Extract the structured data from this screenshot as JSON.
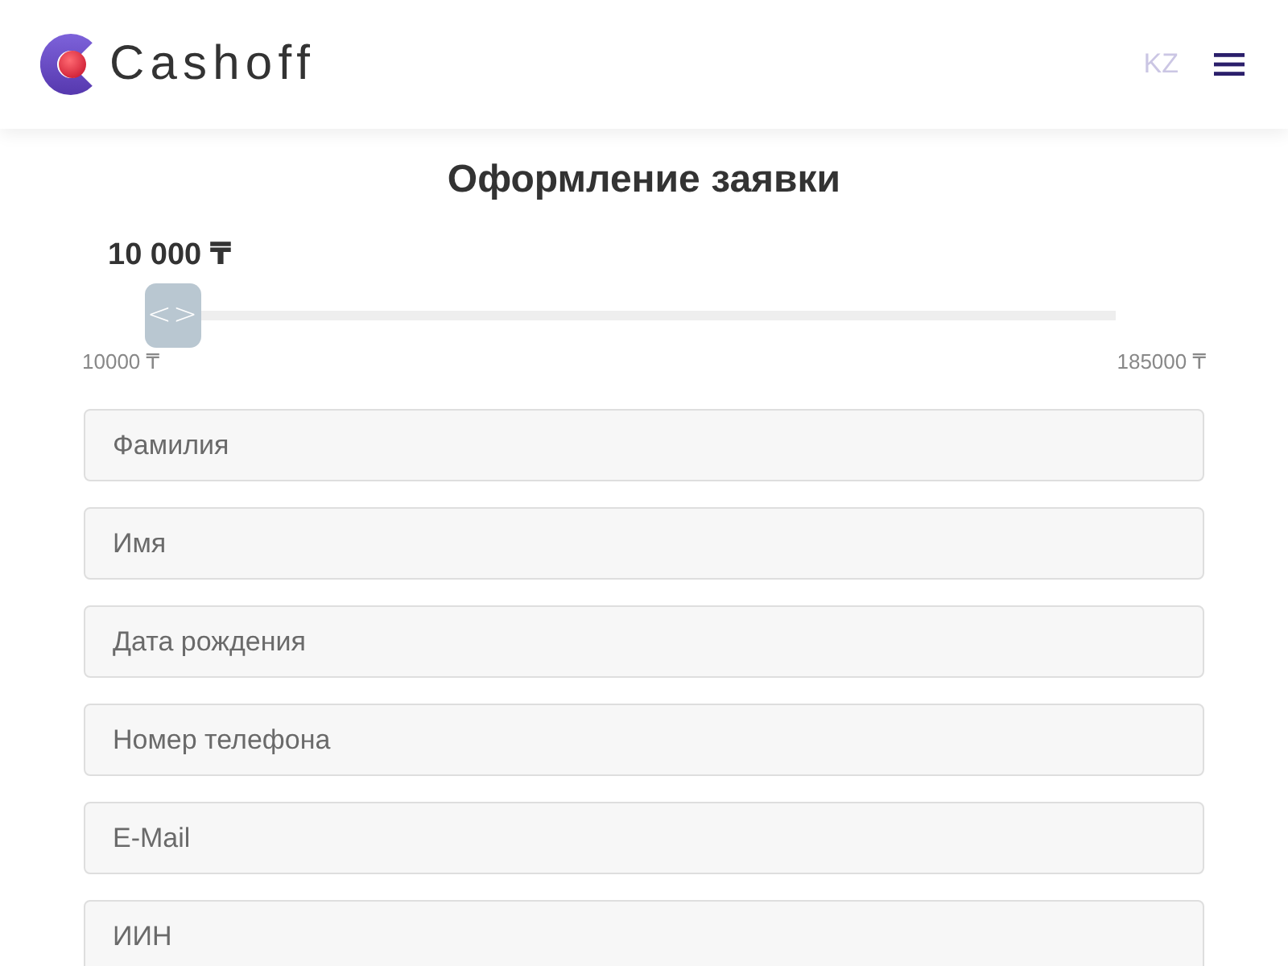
{
  "header": {
    "logo_text": "Cashoff",
    "language": "KZ"
  },
  "form": {
    "title": "Оформление заявки",
    "amount": "10 000 ₸",
    "slider": {
      "level": 0,
      "thumb_text": "<>",
      "min_label": "10000 ₸",
      "max_label": "185000 ₸"
    },
    "fields": [
      {
        "placeholder": "Фамилия"
      },
      {
        "placeholder": "Имя"
      },
      {
        "placeholder": "Дата рождения"
      },
      {
        "placeholder": "Номер телефона"
      },
      {
        "placeholder": "E-Mail"
      },
      {
        "placeholder": "ИИН"
      }
    ]
  }
}
